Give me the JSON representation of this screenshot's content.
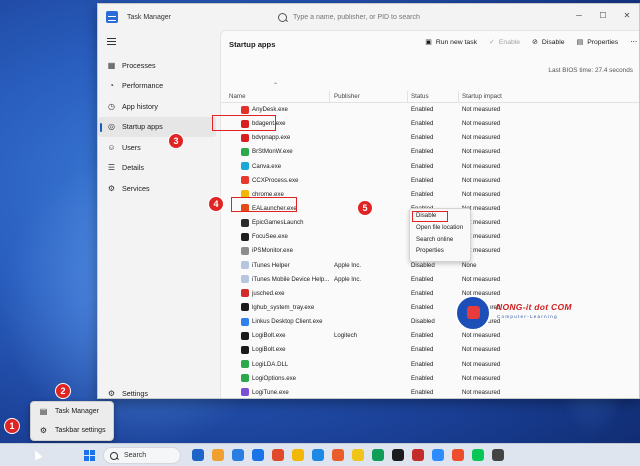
{
  "window": {
    "title": "Task Manager",
    "search_placeholder": "Type a name, publisher, or PID to search",
    "controls": {
      "minimize": "─",
      "maximize": "☐",
      "close": "✕"
    }
  },
  "sidebar": {
    "items": [
      {
        "label": "Processes",
        "icon": "processes-icon",
        "glyph": "▦"
      },
      {
        "label": "Performance",
        "icon": "performance-icon",
        "glyph": "◔"
      },
      {
        "label": "App history",
        "icon": "history-icon",
        "glyph": "◷"
      },
      {
        "label": "Startup apps",
        "icon": "startup-icon",
        "glyph": "◎"
      },
      {
        "label": "Users",
        "icon": "users-icon",
        "glyph": "☺"
      },
      {
        "label": "Details",
        "icon": "details-icon",
        "glyph": "☰"
      },
      {
        "label": "Services",
        "icon": "services-icon",
        "glyph": "⚙"
      }
    ],
    "settings": {
      "label": "Settings",
      "glyph": "⚙"
    }
  },
  "main": {
    "title": "Startup apps",
    "toolbar": {
      "run_new_task": "Run new task",
      "enable": "Enable",
      "disable": "Disable",
      "properties": "Properties",
      "more": "⋯"
    },
    "bios_label": "Last BIOS time:",
    "bios_value": "27.4 seconds",
    "columns": {
      "name": "Name",
      "publisher": "Publisher",
      "status": "Status",
      "impact": "Startup impact"
    },
    "rows": [
      {
        "name": "AnyDesk.exe",
        "publisher": "",
        "status": "Enabled",
        "impact": "Not measured",
        "color": "#e0322a"
      },
      {
        "name": "bdagent.exe",
        "publisher": "",
        "status": "Enabled",
        "impact": "Not measured",
        "color": "#d81e1e"
      },
      {
        "name": "bdvpnapp.exe",
        "publisher": "",
        "status": "Enabled",
        "impact": "Not measured",
        "color": "#d81e1e"
      },
      {
        "name": "BrStMonW.exe",
        "publisher": "",
        "status": "Enabled",
        "impact": "Not measured",
        "color": "#2aa84a"
      },
      {
        "name": "Canva.exe",
        "publisher": "",
        "status": "Enabled",
        "impact": "Not measured",
        "color": "#1aa9d6"
      },
      {
        "name": "CCXProcess.exe",
        "publisher": "",
        "status": "Enabled",
        "impact": "Not measured",
        "color": "#e8392d"
      },
      {
        "name": "chrome.exe",
        "publisher": "",
        "status": "Enabled",
        "impact": "Not measured",
        "color": "#f2b705"
      },
      {
        "name": "EALauncher.exe",
        "publisher": "",
        "status": "Enabled",
        "impact": "Not measured",
        "color": "#e44a14"
      },
      {
        "name": "EpicGamesLaunch",
        "publisher": "",
        "status": "Enabled",
        "impact": "Not measured",
        "color": "#2b2b2b"
      },
      {
        "name": "FocuSee.exe",
        "publisher": "",
        "status": "Enabled",
        "impact": "Not measured",
        "color": "#1e1e1e"
      },
      {
        "name": "iPSMonitor.exe",
        "publisher": "",
        "status": "Enabled",
        "impact": "Not measured",
        "color": "#8d8d8d"
      },
      {
        "name": "iTunes Helper",
        "publisher": "Apple Inc.",
        "status": "Disabled",
        "impact": "None",
        "color": "#b7c6e0"
      },
      {
        "name": "iTunes Mobile Device Help...",
        "publisher": "Apple Inc.",
        "status": "Enabled",
        "impact": "Not measured",
        "color": "#b7c6e0"
      },
      {
        "name": "jusched.exe",
        "publisher": "",
        "status": "Enabled",
        "impact": "Not measured",
        "color": "#d12b2b"
      },
      {
        "name": "lghub_system_tray.exe",
        "publisher": "",
        "status": "Enabled",
        "impact": "Not measured",
        "color": "#1b1b1b"
      },
      {
        "name": "Linkus Desktop Client.exe",
        "publisher": "",
        "status": "Disabled",
        "impact": "Not measured",
        "color": "#2f80ed"
      },
      {
        "name": "LogiBolt.exe",
        "publisher": "Logitech",
        "status": "Enabled",
        "impact": "Not measured",
        "color": "#1b1b1b"
      },
      {
        "name": "LogiBolt.exe",
        "publisher": "",
        "status": "Enabled",
        "impact": "Not measured",
        "color": "#1b1b1b"
      },
      {
        "name": "LogiLDA.DLL",
        "publisher": "",
        "status": "Enabled",
        "impact": "Not measured",
        "color": "#2aa84a"
      },
      {
        "name": "LogiOptions.exe",
        "publisher": "",
        "status": "Enabled",
        "impact": "Not measured",
        "color": "#2aa84a"
      },
      {
        "name": "LogiTune.exe",
        "publisher": "",
        "status": "Enabled",
        "impact": "Not measured",
        "color": "#7a4fd6"
      }
    ]
  },
  "context_menu": {
    "items": [
      "Disable",
      "Open file location",
      "Search online",
      "Properties"
    ]
  },
  "popup": {
    "items": [
      {
        "label": "Task Manager",
        "glyph": "▤"
      },
      {
        "label": "Taskbar settings",
        "glyph": "⚙"
      }
    ]
  },
  "badges": [
    "1",
    "2",
    "3",
    "4",
    "5"
  ],
  "watermark": {
    "title": "NONG-it dot COM",
    "subtitle": "Computer-Learning"
  },
  "taskbar": {
    "search_label": "Search",
    "apps": [
      "#1e64c8",
      "#f0a030",
      "#2a7de1",
      "#1a73e8",
      "#e04a2a",
      "#f2b705",
      "#1e88e5",
      "#e85d2a",
      "#f0c419",
      "#0f9d58",
      "#1b1b1b",
      "#c42b2b",
      "#2d8cff",
      "#ee4d2d",
      "#06c755",
      "#444444"
    ]
  }
}
